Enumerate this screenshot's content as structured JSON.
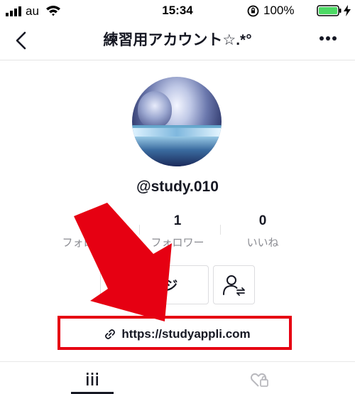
{
  "status_bar": {
    "carrier": "au",
    "time": "15:34",
    "battery_percent": "100%",
    "battery_level": 1.0,
    "icons": [
      "cellular-signal-icon",
      "wifi-icon",
      "orientation-lock-icon",
      "battery-icon",
      "charging-icon"
    ]
  },
  "header": {
    "back_icon": "back-chevron-icon",
    "title": "練習用アカウント☆.*°",
    "more_icon": "more-dots-icon"
  },
  "profile": {
    "username": "@study.010",
    "stats": [
      {
        "value": "",
        "label": "フォロ"
      },
      {
        "value": "1",
        "label": "フォロワー"
      },
      {
        "value": "0",
        "label": "いいね"
      }
    ],
    "edit_button_label": "ージ",
    "add_friend_icon": "add-friend-icon",
    "link_icon": "link-icon",
    "link_url": "https://studyappli.com"
  },
  "annotation": {
    "arrow_color": "#e60012",
    "box_color": "#e60012"
  },
  "tabs": [
    {
      "icon": "videos-grid-icon",
      "active": true
    },
    {
      "icon": "liked-videos-icon",
      "active": false
    }
  ]
}
